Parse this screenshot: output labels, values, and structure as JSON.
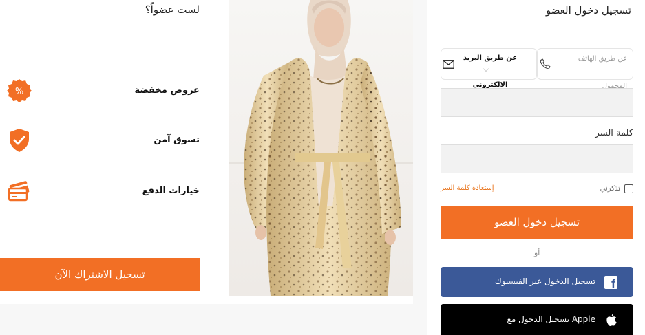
{
  "login": {
    "title": "تسجيل دخول العضو",
    "method_phone_label": "عن طريق الهاتف المحمول",
    "method_email_label": "عن طريق البريد الالكتروني",
    "password_label": "كلمة السر",
    "remember_label": "تذكرني",
    "forgot_label": "إستعادة كلمة السر",
    "submit_label": "تسجيل دخول العضو",
    "or_label": "أو",
    "facebook_label": "تسجيل الدخول عبر الفيسبوك",
    "apple_label": "Apple تسجيل الدخول مع"
  },
  "signup": {
    "title": "لست عضواً؟",
    "benefits": [
      {
        "label": "عروض مخفضة",
        "icon": "discount-badge-icon"
      },
      {
        "label": "تسوق آمن",
        "icon": "shield-check-icon"
      },
      {
        "label": "خيارات الدفع",
        "icon": "credit-cards-icon"
      }
    ],
    "register_label": "تسجيل الاشتراك الآن"
  },
  "colors": {
    "accent": "#f26f25",
    "facebook": "#3b5998",
    "apple": "#000000"
  }
}
